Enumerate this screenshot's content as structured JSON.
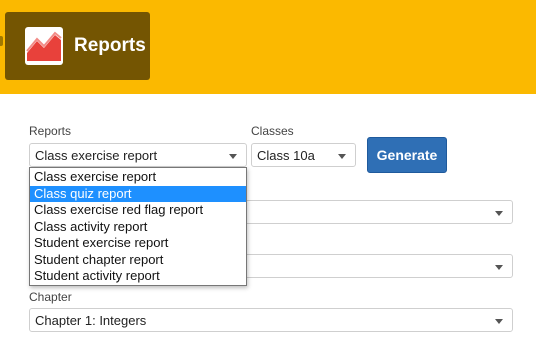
{
  "header": {
    "title": "Reports",
    "icon": "line-chart-icon",
    "bg_color": "#fbb900",
    "badge_color": "#745502"
  },
  "reports": {
    "label": "Reports",
    "selected": "Class exercise report",
    "options": [
      "Class exercise report",
      "Class quiz report",
      "Class exercise red flag report",
      "Class activity report",
      "Student exercise report",
      "Student chapter report",
      "Student activity report"
    ],
    "highlighted_index": 1
  },
  "classes": {
    "label": "Classes",
    "selected": "Class 10a"
  },
  "generate_label": "Generate",
  "chapter": {
    "label": "Chapter",
    "selected": "Chapter 1: Integers"
  },
  "colors": {
    "button": "#2f6fb5",
    "highlight": "#1e90ff"
  }
}
